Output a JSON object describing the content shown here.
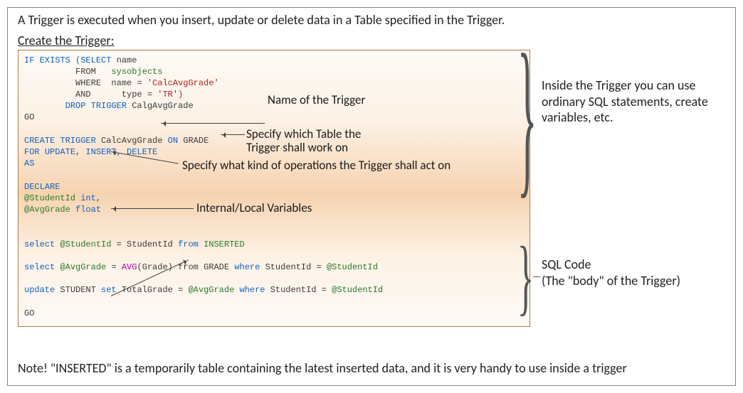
{
  "intro": "A Trigger is executed when you insert, update or delete data in a Table specified in the Trigger.",
  "create_heading": "Create the Trigger:",
  "code": {
    "l1a": "IF EXISTS ",
    "l1b": "(SELECT",
    "l1c": " name",
    "l2a": "          FROM   ",
    "l2b": "sysobjects",
    "l3a": "          WHERE  ",
    "l3b": "name ",
    "l3c": "= ",
    "l3d": "'CalcAvgGrade'",
    "l4a": "          AND      ",
    "l4b": "type ",
    "l4c": "= ",
    "l4d": "'TR')",
    "l5a": "        DROP TRIGGER ",
    "l5b": "CalgAvgGrade",
    "l6": "GO",
    "l8a": "CREATE TRIGGER ",
    "l8b": "CalcAvgGrade",
    "l8c": " ON ",
    "l8d": "GRADE",
    "l9a": "FOR ",
    "l9b": "UPDATE, INSERT, DELETE",
    "l10": "AS",
    "l12": "DECLARE",
    "l13a": "@StudentId ",
    "l13b": "int,",
    "l14a": "@AvgGrade ",
    "l14b": "float",
    "l16a": "select ",
    "l16b": "@StudentId ",
    "l16c": "= ",
    "l16d": "StudentId ",
    "l16e": "from ",
    "l16f": "INSERTED",
    "l18a": "select ",
    "l18b": "@AvgGrade ",
    "l18c": "= ",
    "l18d": "AVG",
    "l18e": "(Grade) from ",
    "l18f": "GRADE ",
    "l18g": "where ",
    "l18h": "StudentId ",
    "l18i": "= ",
    "l18j": "@StudentId",
    "l20a": "update ",
    "l20b": "STUDENT ",
    "l20c": "set ",
    "l20d": "TotalGrade ",
    "l20e": "= ",
    "l20f": "@AvgGrade ",
    "l20g": "where ",
    "l20h": "StudentId ",
    "l20i": "= ",
    "l20j": "@StudentId",
    "l22": "GO"
  },
  "annot": {
    "name": "Name of the Trigger",
    "table": "Specify which Table the Trigger shall work on",
    "ops": "Specify what kind of operations the Trigger shall act on",
    "vars": "Internal/Local Variables"
  },
  "right1": "Inside the Trigger you can use ordinary SQL statements, create variables, etc.",
  "right2": "SQL Code",
  "right2b": "(The \"body\" of the Trigger)",
  "note": "Note! \"INSERTED\" is a temporarily table containing the latest inserted data, and it is very handy to use inside a trigger"
}
